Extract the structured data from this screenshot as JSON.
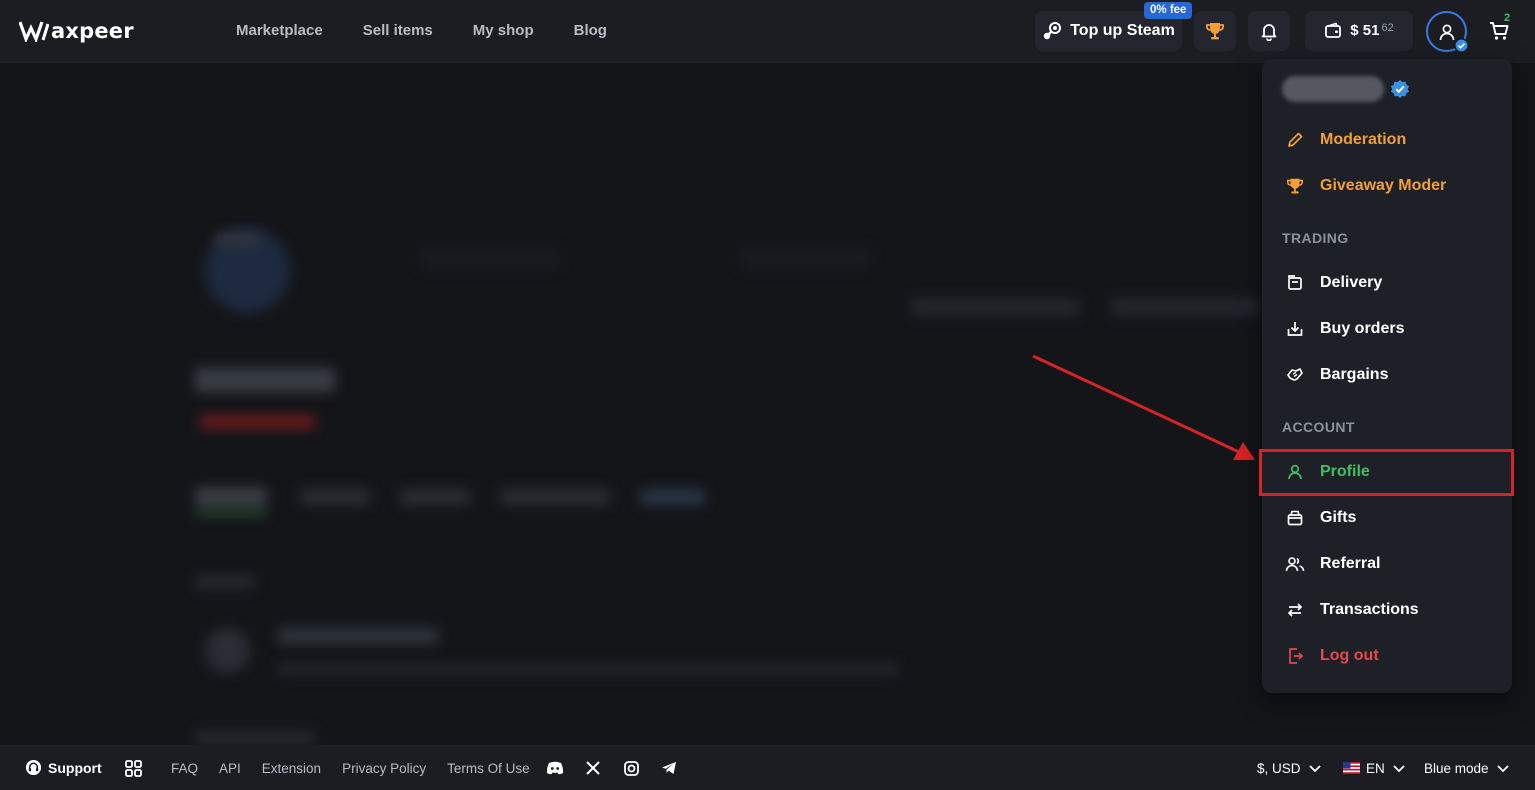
{
  "brand": {
    "name": "axpeer"
  },
  "nav": {
    "items": [
      "Marketplace",
      "Sell items",
      "My shop",
      "Blog"
    ]
  },
  "header": {
    "topup_label": "Top up Steam",
    "fee_badge": "0% fee",
    "balance_main": "$ 51",
    "balance_cents": "62",
    "cart_count": "2"
  },
  "menu": {
    "moderation": "Moderation",
    "giveaway_moder": "Giveaway Moder",
    "section_trading": "TRADING",
    "delivery": "Delivery",
    "buy_orders": "Buy orders",
    "bargains": "Bargains",
    "section_account": "ACCOUNT",
    "profile": "Profile",
    "gifts": "Gifts",
    "referral": "Referral",
    "transactions": "Transactions",
    "log_out": "Log out"
  },
  "footer": {
    "support": "Support",
    "links": [
      "FAQ",
      "API",
      "Extension",
      "Privacy Policy",
      "Terms Of Use"
    ],
    "currency": "$, USD",
    "language": "EN",
    "theme": "Blue mode"
  },
  "colors": {
    "accent_blue": "#2767d8",
    "orange": "#f2a033",
    "green": "#3fbf63",
    "red": "#e5484d",
    "highlight": "#d62327"
  },
  "icons": {
    "header": [
      "steam-icon",
      "trophy-icon",
      "bell-icon",
      "wallet-icon",
      "user-icon",
      "cart-icon"
    ],
    "footer": [
      "support-icon",
      "apps-grid-icon",
      "discord-icon",
      "x-icon",
      "instagram-icon",
      "telegram-icon",
      "us-flag-icon"
    ]
  }
}
